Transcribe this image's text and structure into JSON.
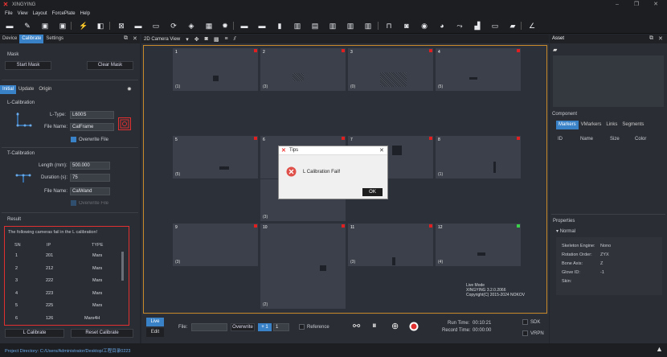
{
  "app": {
    "title": "XINGYING"
  },
  "menu": [
    "File",
    "View",
    "Layout",
    "ForcePlate",
    "Help"
  ],
  "left_panel": {
    "tabs": [
      "Device",
      "Calibrate",
      "Settings"
    ],
    "mask": {
      "title": "Mask",
      "start": "Start Mask",
      "clear": "Clear Mask"
    },
    "subtabs": [
      "Initial",
      "Update",
      "Origin"
    ],
    "lcal": {
      "title": "L-Calibration",
      "ltype_label": "L-Type:",
      "ltype_value": "L600S",
      "fname_label": "File Name:",
      "fname_value": "CalFrame",
      "overwrite": "Overwrite File"
    },
    "tcal": {
      "title": "T-Calibration",
      "length_label": "Length (mm):",
      "length_value": "500.000",
      "duration_label": "Duration (s):",
      "duration_value": "75",
      "fname_label": "File Name:",
      "fname_value": "CalWand",
      "overwrite": "Overwrite File"
    },
    "result": {
      "title": "Result",
      "message": "The following cameras fail in the L calibration!",
      "headers": [
        "SN",
        "IP",
        "TYPE"
      ],
      "rows": [
        [
          "1",
          "201",
          "Mars"
        ],
        [
          "2",
          "212",
          "Mars"
        ],
        [
          "3",
          "222",
          "Mars"
        ],
        [
          "4",
          "223",
          "Mars"
        ],
        [
          "5",
          "225",
          "Mars"
        ],
        [
          "6",
          "126",
          "Mars4H"
        ]
      ]
    },
    "buttons": {
      "calibrate": "L Calibrate",
      "reset": "Reset Calibrate"
    }
  },
  "viewport": {
    "title": "2D Camera View",
    "cameras": [
      {
        "n": "1",
        "s": "(1)"
      },
      {
        "n": "2",
        "s": "(3)"
      },
      {
        "n": "3",
        "s": "(0)"
      },
      {
        "n": "4",
        "s": "(5)"
      },
      {
        "n": "5",
        "s": "(5)"
      },
      {
        "n": "6",
        "s": "(3)"
      },
      {
        "n": "7",
        "s": ""
      },
      {
        "n": "8",
        "s": "(1)"
      },
      {
        "n": "9",
        "s": "(3)"
      },
      {
        "n": "10",
        "s": "(2)"
      },
      {
        "n": "11",
        "s": "(3)"
      },
      {
        "n": "12",
        "s": "(4)"
      }
    ],
    "live_mode": [
      "Live Mode",
      "XINGYING 3.2.0.2066",
      "Copyright(C) 2015-2024 NOKOV"
    ]
  },
  "dialog": {
    "title": "Tips",
    "message": "L Calibration Fail!",
    "ok": "OK"
  },
  "bottom": {
    "live": "Live",
    "edit": "Edit",
    "file_label": "File:",
    "overwrite": "Overwrite",
    "plus": "+ 1",
    "num": "1",
    "reference": "Reference",
    "run_time_label": "Run Time:",
    "run_time": "00:10:21",
    "record_time_label": "Record Time:",
    "record_time": "00:00:00",
    "sdk": "SDK",
    "vrpn": "VRPN"
  },
  "right_panel": {
    "asset": "Asset",
    "component": "Component",
    "comp_tabs": [
      "Markers",
      "VMarkers",
      "Links",
      "Segments"
    ],
    "comp_headers": [
      "ID",
      "Name",
      "Size",
      "Color"
    ],
    "properties": "Properties",
    "normal": "Normal",
    "props": [
      {
        "k": "Skeleton Engine:",
        "v": "Nono"
      },
      {
        "k": "Rotation Order:",
        "v": "ZYX"
      },
      {
        "k": "Bone Axis:",
        "v": "Z"
      },
      {
        "k": "Glove ID:",
        "v": "-1"
      },
      {
        "k": "Skin:",
        "v": ""
      }
    ]
  },
  "status": {
    "project": "Project Directory:  C:/Users/Administrator/Desktop/工程目录0223"
  },
  "colors": {
    "accent": "#3a82c8",
    "error": "#e03030",
    "frame": "#c8892a"
  }
}
